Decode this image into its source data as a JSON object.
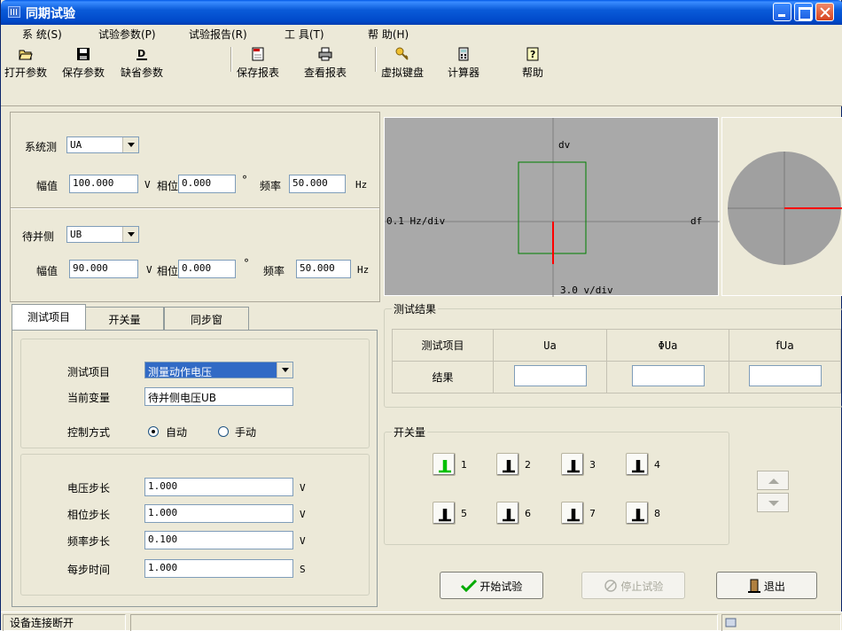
{
  "window": {
    "title": "同期试验"
  },
  "menu": [
    "系 统(S)",
    "试验参数(P)",
    "试验报告(R)",
    "工 具(T)",
    "帮 助(H)"
  ],
  "toolbar": {
    "open": "打开参数",
    "save": "保存参数",
    "default": "缺省参数",
    "save_report": "保存报表",
    "view_report": "查看报表",
    "vkeyboard": "虚拟键盘",
    "calculator": "计算器",
    "help": "帮助"
  },
  "system_side": {
    "label": "系统测",
    "channel": "UA",
    "amp_label": "幅值",
    "amp": "100.000",
    "amp_unit": "V",
    "phase_label": "相位",
    "phase": "0.000",
    "phase_unit": "°",
    "freq_label": "频率",
    "freq": "50.000",
    "freq_unit": "Hz"
  },
  "pending_side": {
    "label": "待并侧",
    "channel": "UB",
    "amp_label": "幅值",
    "amp": "90.000",
    "amp_unit": "V",
    "phase_label": "相位",
    "phase": "0.000",
    "phase_unit": "°",
    "freq_label": "频率",
    "freq": "50.000",
    "freq_unit": "Hz"
  },
  "scope": {
    "dv": "dv",
    "df": "df",
    "xscale": "0.1 Hz/div",
    "yscale": "3.0 v/div"
  },
  "tabs": [
    "测试项目",
    "开关量",
    "同步窗"
  ],
  "test": {
    "item_label": "测试项目",
    "item_value": "测量动作电压",
    "var_label": "当前变量",
    "var_value": "待并侧电压UB",
    "ctrl_label": "控制方式",
    "auto": "自动",
    "manual": "手动"
  },
  "steps": [
    {
      "label": "电压步长",
      "value": "1.000",
      "unit": "V"
    },
    {
      "label": "相位步长",
      "value": "1.000",
      "unit": "V"
    },
    {
      "label": "频率步长",
      "value": "0.100",
      "unit": "V"
    },
    {
      "label": "每步时间",
      "value": "1.000",
      "unit": "S"
    }
  ],
  "results": {
    "title": "测试结果",
    "row1": "测试项目",
    "row2": "结果",
    "cols": [
      "Ua",
      "ΦUa",
      "fUa"
    ]
  },
  "switches": {
    "title": "开关量",
    "labels": [
      "1",
      "2",
      "3",
      "4",
      "5",
      "6",
      "7",
      "8"
    ]
  },
  "buttons": {
    "start": "开始试验",
    "stop": "停止试验",
    "exit": "退出"
  },
  "status": {
    "text": "设备连接断开"
  },
  "colors": {
    "title_blue": "#0054e3",
    "scope_bg": "#a9a9a9",
    "window_green": "#008000",
    "vector_red": "#ff0000",
    "active_switch": "#00c000"
  }
}
